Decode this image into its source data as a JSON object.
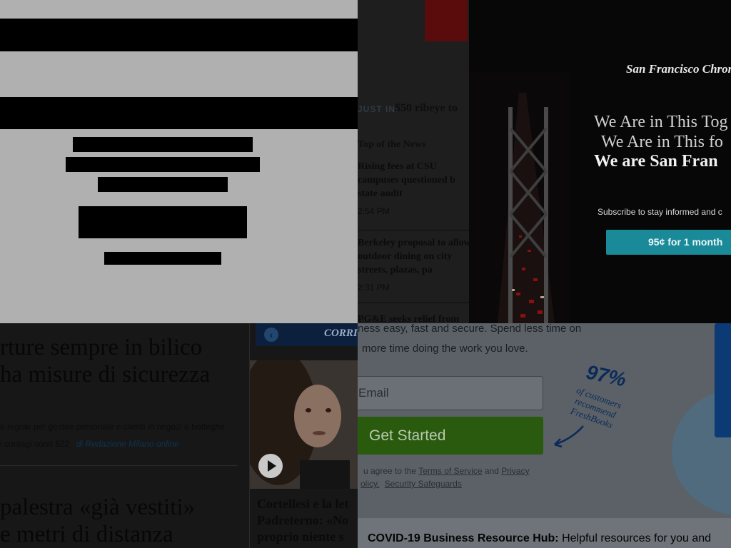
{
  "sfchronicle": {
    "just_in_label": "JUST IN:",
    "just_in_text": "$50 ribeye to",
    "section_title": "Top of the News",
    "stories": [
      {
        "headline": "Rising fees at CSU campuses questioned b state audit",
        "time": "2:54 PM"
      },
      {
        "headline": "Berkeley proposal to allow outdoor dining on city streets, plazas, pa",
        "time": "2:31 PM"
      },
      {
        "headline": "PG&E seeks relief from",
        "time": ""
      }
    ],
    "overlay": {
      "logo": "San Francisco Chronicle",
      "headline_lines": [
        "We Are in This Tog",
        "We Are in This fo",
        "We are San Fran"
      ],
      "subscribe_text": "Subscribe to stay informed and c",
      "offer_button": "95¢ for 1 month"
    }
  },
  "corriere": {
    "headline_lines": [
      "rture sempre in bilico",
      "ha misure di sicurezza"
    ],
    "summary_line": "e regole per gestire personale e clienti in negozi e botteghe",
    "contagi_line": "i contagi sono 522",
    "byline": "di Redazione Milano online",
    "headline2_lines": [
      "palestra «già vestiti»",
      "e metri di distanza"
    ],
    "logo": "CORRI",
    "back_icon": "‹",
    "side_story_lines": [
      "Cortellesi e la let",
      "Padreterno: «No",
      "proprio niente s"
    ]
  },
  "freshbooks": {
    "text_line1": "ness easy, fast and secure. Spend less time on",
    "text_line2": "more time doing the work you love.",
    "email_placeholder": "Email",
    "cta_button": "Get Started",
    "legal_prefix": "u agree to the",
    "terms_link": "Terms of Service",
    "legal_and": "and",
    "privacy_link": "Privacy",
    "policy_link": "olicy.",
    "safeguards_link": "Security Safeguards",
    "badge_pct": "97%",
    "badge_sub_lines": [
      "of customers",
      "recommend",
      "FreshBooks"
    ],
    "covid_label": "COVID-19 Business Resource Hub:",
    "covid_text": "Helpful resources for you and"
  }
}
